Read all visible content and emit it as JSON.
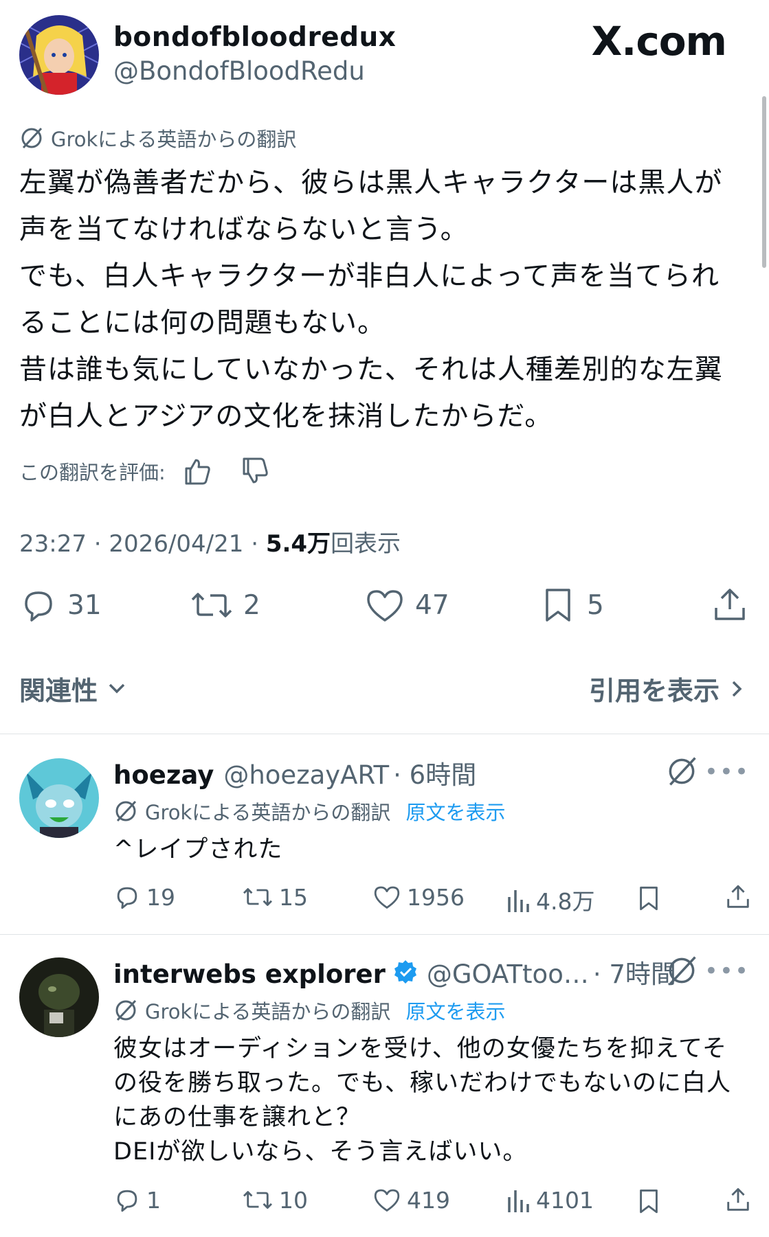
{
  "header": {
    "display_name": "bondofbloodredux",
    "handle": "@BondofBloodRedu",
    "site_label": "X.com"
  },
  "post": {
    "translation_label": "Grokによる英語からの翻訳",
    "text": "左翼が偽善者だから、彼らは黒人キャラクターは黒人が\n声を当てなければならないと言う。\nでも、白人キャラクターが非白人によって声を当てられ\nることには何の問題もない。\n昔は誰も気にしていなかった、それは人種差別的な左翼\nが白人とアジアの文化を抹消したからだ。",
    "rate_label": "この翻訳を評価:",
    "time": "23:27",
    "date": "2026/04/21",
    "views_count": "5.4万",
    "views_label": "回表示",
    "separator": " · ",
    "replies": "31",
    "reposts": "2",
    "likes": "47",
    "bookmarks": "5"
  },
  "sort": {
    "label": "関連性",
    "quotes_link": "引用を表示"
  },
  "replies": [
    {
      "name": "hoezay",
      "handle": "@hoezayART",
      "time": "· 6時間",
      "translation_label": "Grokによる英語からの翻訳",
      "show_original": "原文を表示",
      "text": "^レイプされた",
      "replies": "19",
      "reposts": "15",
      "likes": "1956",
      "views": "4.8万"
    },
    {
      "name": "interwebs explorer",
      "handle": "@GOATtoo…",
      "time": "· 7時間",
      "translation_label": "Grokによる英語からの翻訳",
      "show_original": "原文を表示",
      "text": "彼女はオーディションを受け、他の女優たちを抑えてそ\nの役を勝ち取った。でも、稼いだわけでもないのに白人\nにあの仕事を譲れと？\nDEIが欲しいなら、そう言えばいい。",
      "replies": "1",
      "reposts": "10",
      "likes": "419",
      "views": "4101"
    }
  ],
  "colors": {
    "text": "#0f1419",
    "secondary": "#536471",
    "link": "#1d9bf0",
    "verified": "#1d9bf0"
  }
}
